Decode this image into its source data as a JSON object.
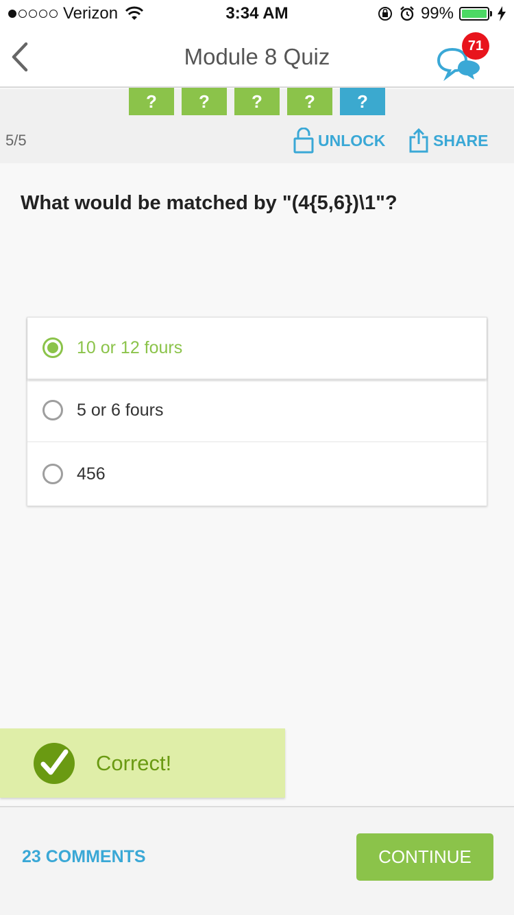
{
  "status_bar": {
    "carrier": "Verizon",
    "time": "3:34 AM",
    "battery_percent": "99%",
    "battery_level": 0.99,
    "signal_bars_filled": 1,
    "signal_bars_total": 5
  },
  "nav": {
    "title": "Module 8 Quiz",
    "comments_badge": "71",
    "back_icon": "chevron-left-icon",
    "comments_icon": "chat-bubbles-icon"
  },
  "progress": {
    "steps": [
      {
        "label": "?",
        "state": "done"
      },
      {
        "label": "?",
        "state": "done"
      },
      {
        "label": "?",
        "state": "done"
      },
      {
        "label": "?",
        "state": "done"
      },
      {
        "label": "?",
        "state": "current"
      }
    ],
    "counter": "5/5"
  },
  "actions": {
    "unlock_label": "UNLOCK",
    "share_label": "SHARE"
  },
  "question": {
    "text": "What would be matched by \"(4{5,6})\\1\"?"
  },
  "answers": [
    {
      "label": "10 or 12 fours",
      "selected": true
    },
    {
      "label": "5 or 6 fours",
      "selected": false
    },
    {
      "label": "456",
      "selected": false
    }
  ],
  "result": {
    "text": "Correct!"
  },
  "footer": {
    "comments_label": "23 COMMENTS",
    "continue_label": "CONTINUE"
  },
  "colors": {
    "accent_green": "#8bc34a",
    "accent_blue": "#3ba9cf",
    "badge_red": "#e8141c",
    "correct_bg": "#dfeea8"
  }
}
